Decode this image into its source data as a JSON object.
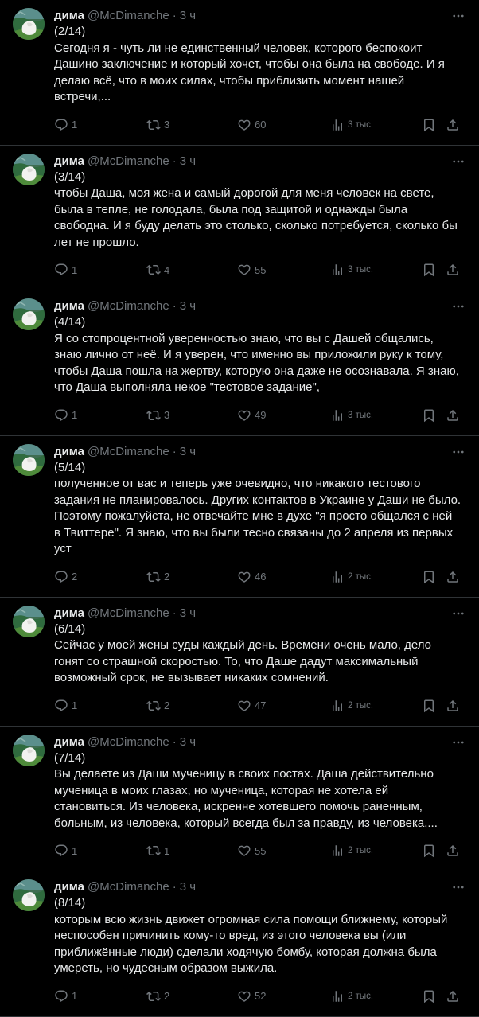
{
  "colors": {
    "background": "#000000",
    "text": "#e7e9ea",
    "secondary": "#71767b",
    "divider": "#2f3336"
  },
  "author": {
    "display_name": "дима",
    "handle": "@McDimanche",
    "separator": "·",
    "time": "3 ч"
  },
  "tweets": [
    {
      "text": "(2/14)\nСегодня я - чуть ли не единственный человек, которого беспокоит Дашино заключение и который хочет, чтобы она была на свободе. И я делаю всё, что в моих силах, чтобы приблизить момент нашей встречи,...",
      "replies": "1",
      "retweets": "3",
      "likes": "60",
      "views": "3 тыс."
    },
    {
      "text": "(3/14)\nчтобы Даша, моя жена и самый дорогой для меня человек на свете, была в тепле, не голодала, была под защитой и однажды была свободна. И я буду делать это столько, сколько потребуется, сколько бы лет не прошло.",
      "replies": "1",
      "retweets": "4",
      "likes": "55",
      "views": "3 тыс."
    },
    {
      "text": "(4/14)\nЯ со стопроцентной уверенностью знаю, что вы с Дашей общались, знаю лично от неё. И я уверен, что именно вы приложили руку к тому, чтобы Даша пошла на жертву, которую она даже не осознавала. Я знаю, что Даша выполняла некое \"тестовое задание\",",
      "replies": "1",
      "retweets": "3",
      "likes": "49",
      "views": "3 тыс."
    },
    {
      "text": "(5/14)\nполученное от вас и теперь уже очевидно, что никакого тестового задания не планировалось. Других контактов в Украине у Даши не было. Поэтому пожалуйста, не отвечайте мне в духе \"я просто общался с ней в Твиттере\". Я знаю, что вы были тесно связаны до 2 апреля из первых уст",
      "replies": "2",
      "retweets": "2",
      "likes": "46",
      "views": "2 тыс."
    },
    {
      "text": "(6/14)\nСейчас у моей жены суды каждый день. Времени очень мало, дело гонят со страшной скоростью. То, что Даше дадут максимальный возможный срок, не вызывает никаких сомнений.",
      "replies": "1",
      "retweets": "2",
      "likes": "47",
      "views": "2 тыс."
    },
    {
      "text": "(7/14)\nВы делаете из Даши мученицу в своих постах. Даша действительно мученица в моих глазах, но мученица, которая не хотела ей становиться. Из человека, искренне хотевшего помочь раненным, больным, из человека, который всегда был за правду, из человека,...",
      "replies": "1",
      "retweets": "1",
      "likes": "55",
      "views": "2 тыс."
    },
    {
      "text": "(8/14)\nкоторым всю жизнь движет огромная сила помощи ближнему, который неспособен причинить кому-то вред, из этого человека вы (или приближённые люди) сделали ходячую бомбу, которая должна была умереть, но чудесным образом выжила.",
      "replies": "1",
      "retweets": "2",
      "likes": "52",
      "views": "2 тыс."
    }
  ]
}
